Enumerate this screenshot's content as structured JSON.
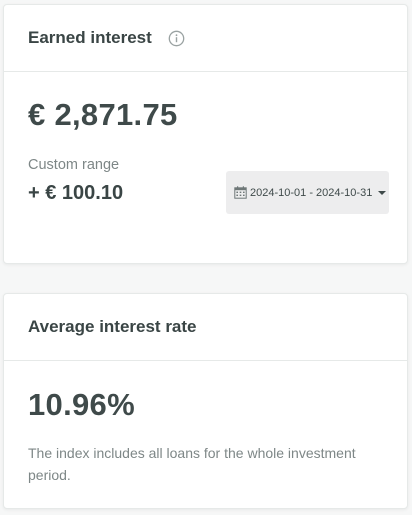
{
  "earned_interest": {
    "title": "Earned interest",
    "info_icon": "info-icon",
    "total": "€ 2,871.75",
    "range_label": "Custom range",
    "range_value": "+ € 100.10",
    "date_range": "2024-10-01 - 2024-10-31",
    "calendar_icon": "calendar-icon",
    "dropdown_icon": "caret-down-icon"
  },
  "average_rate": {
    "title": "Average interest rate",
    "value": "10.96%",
    "note": "The index includes all loans for the whole investment period."
  },
  "colors": {
    "background": "#f6f7f7",
    "card": "#ffffff",
    "text_dark": "#3f4a4a",
    "text_muted": "#7e8787",
    "picker_bg": "#ededee"
  }
}
